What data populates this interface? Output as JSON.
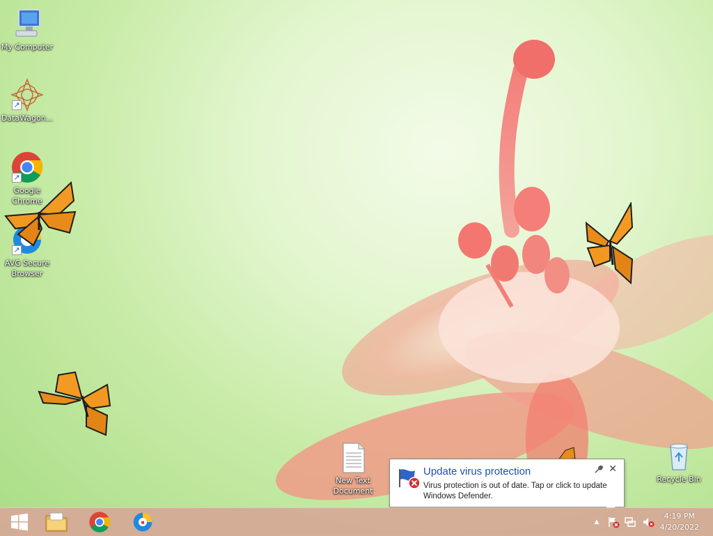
{
  "desktop": {
    "icons": [
      {
        "label": "My Computer"
      },
      {
        "label": "DataWagon..."
      },
      {
        "label": "Google Chrome"
      },
      {
        "label": "AVG Secure Browser"
      },
      {
        "label": "New Text Document"
      },
      {
        "label": "Recycle Bin"
      }
    ]
  },
  "notification": {
    "title": "Update virus protection",
    "message": "Virus protection is out of date. Tap or click to update Windows Defender.",
    "close_icon": "close-icon",
    "options_icon": "wrench-icon"
  },
  "taskbar": {
    "start_icon": "windows-logo-icon",
    "pinned": [
      "file-explorer-icon",
      "google-chrome-icon",
      "avg-secure-browser-icon"
    ],
    "tray": [
      "show-hidden-icons-chevron",
      "action-center-flag-icon",
      "network-icon",
      "volume-muted-icon"
    ],
    "clock_time": "4:19 PM",
    "clock_date": "4/20/2022"
  },
  "colors": {
    "taskbar": "#d6a896",
    "accent_title": "#1f4fb6",
    "error_red": "#d92b2b"
  }
}
